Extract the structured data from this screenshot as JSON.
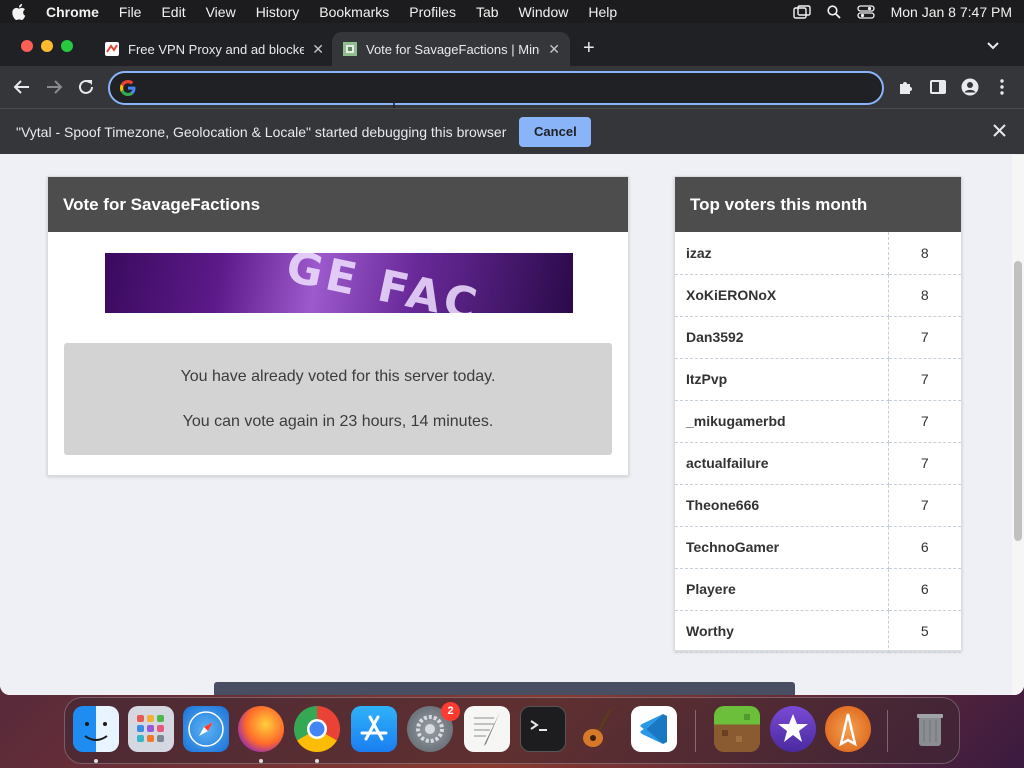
{
  "menubar": {
    "app_name": "Chrome",
    "items": [
      "File",
      "Edit",
      "View",
      "History",
      "Bookmarks",
      "Profiles",
      "Tab",
      "Window",
      "Help"
    ],
    "datetime": "Mon Jan 8  7:47 PM"
  },
  "browser": {
    "tabs": [
      {
        "title": "Free VPN Proxy and ad blocker",
        "active": false
      },
      {
        "title": "Vote for SavageFactions | Minecraft",
        "active": true
      }
    ],
    "new_tab_symbol": "+",
    "address_bar": {
      "value": "",
      "placeholder": ""
    },
    "infobar": {
      "message": "\"Vytal - Spoof Timezone, Geolocation & Locale\" started debugging this browser",
      "cancel_label": "Cancel"
    }
  },
  "vote_panel": {
    "title": "Vote for SavageFactions",
    "banner_text": "GE FAC",
    "already_voted": "You have already voted for this server today.",
    "vote_again": "You can vote again in 23 hours, 14 minutes."
  },
  "top_voters": {
    "title": "Top voters this month",
    "rows": [
      {
        "name": "izaz",
        "votes": "8"
      },
      {
        "name": "XoKiERONoX",
        "votes": "8"
      },
      {
        "name": "Dan3592",
        "votes": "7"
      },
      {
        "name": "ItzPvp",
        "votes": "7"
      },
      {
        "name": "_mikugamerbd",
        "votes": "7"
      },
      {
        "name": "actualfailure",
        "votes": "7"
      },
      {
        "name": "Theone666",
        "votes": "7"
      },
      {
        "name": "TechnoGamer",
        "votes": "6"
      },
      {
        "name": "Playere",
        "votes": "6"
      },
      {
        "name": "Worthy",
        "votes": "5"
      }
    ]
  },
  "dock": {
    "apps": [
      "finder",
      "launchpad",
      "safari",
      "firefox",
      "chrome",
      "app-store",
      "system-settings",
      "textedit",
      "terminal",
      "garageband",
      "vscode",
      "minecraft",
      "imovie",
      "vpn-app",
      "trash"
    ],
    "system_settings_badge": "2"
  },
  "colors": {
    "accent": "#8ab4f8",
    "card_header": "#4d4d4d",
    "vote_message_bg": "#d3d3d3"
  }
}
